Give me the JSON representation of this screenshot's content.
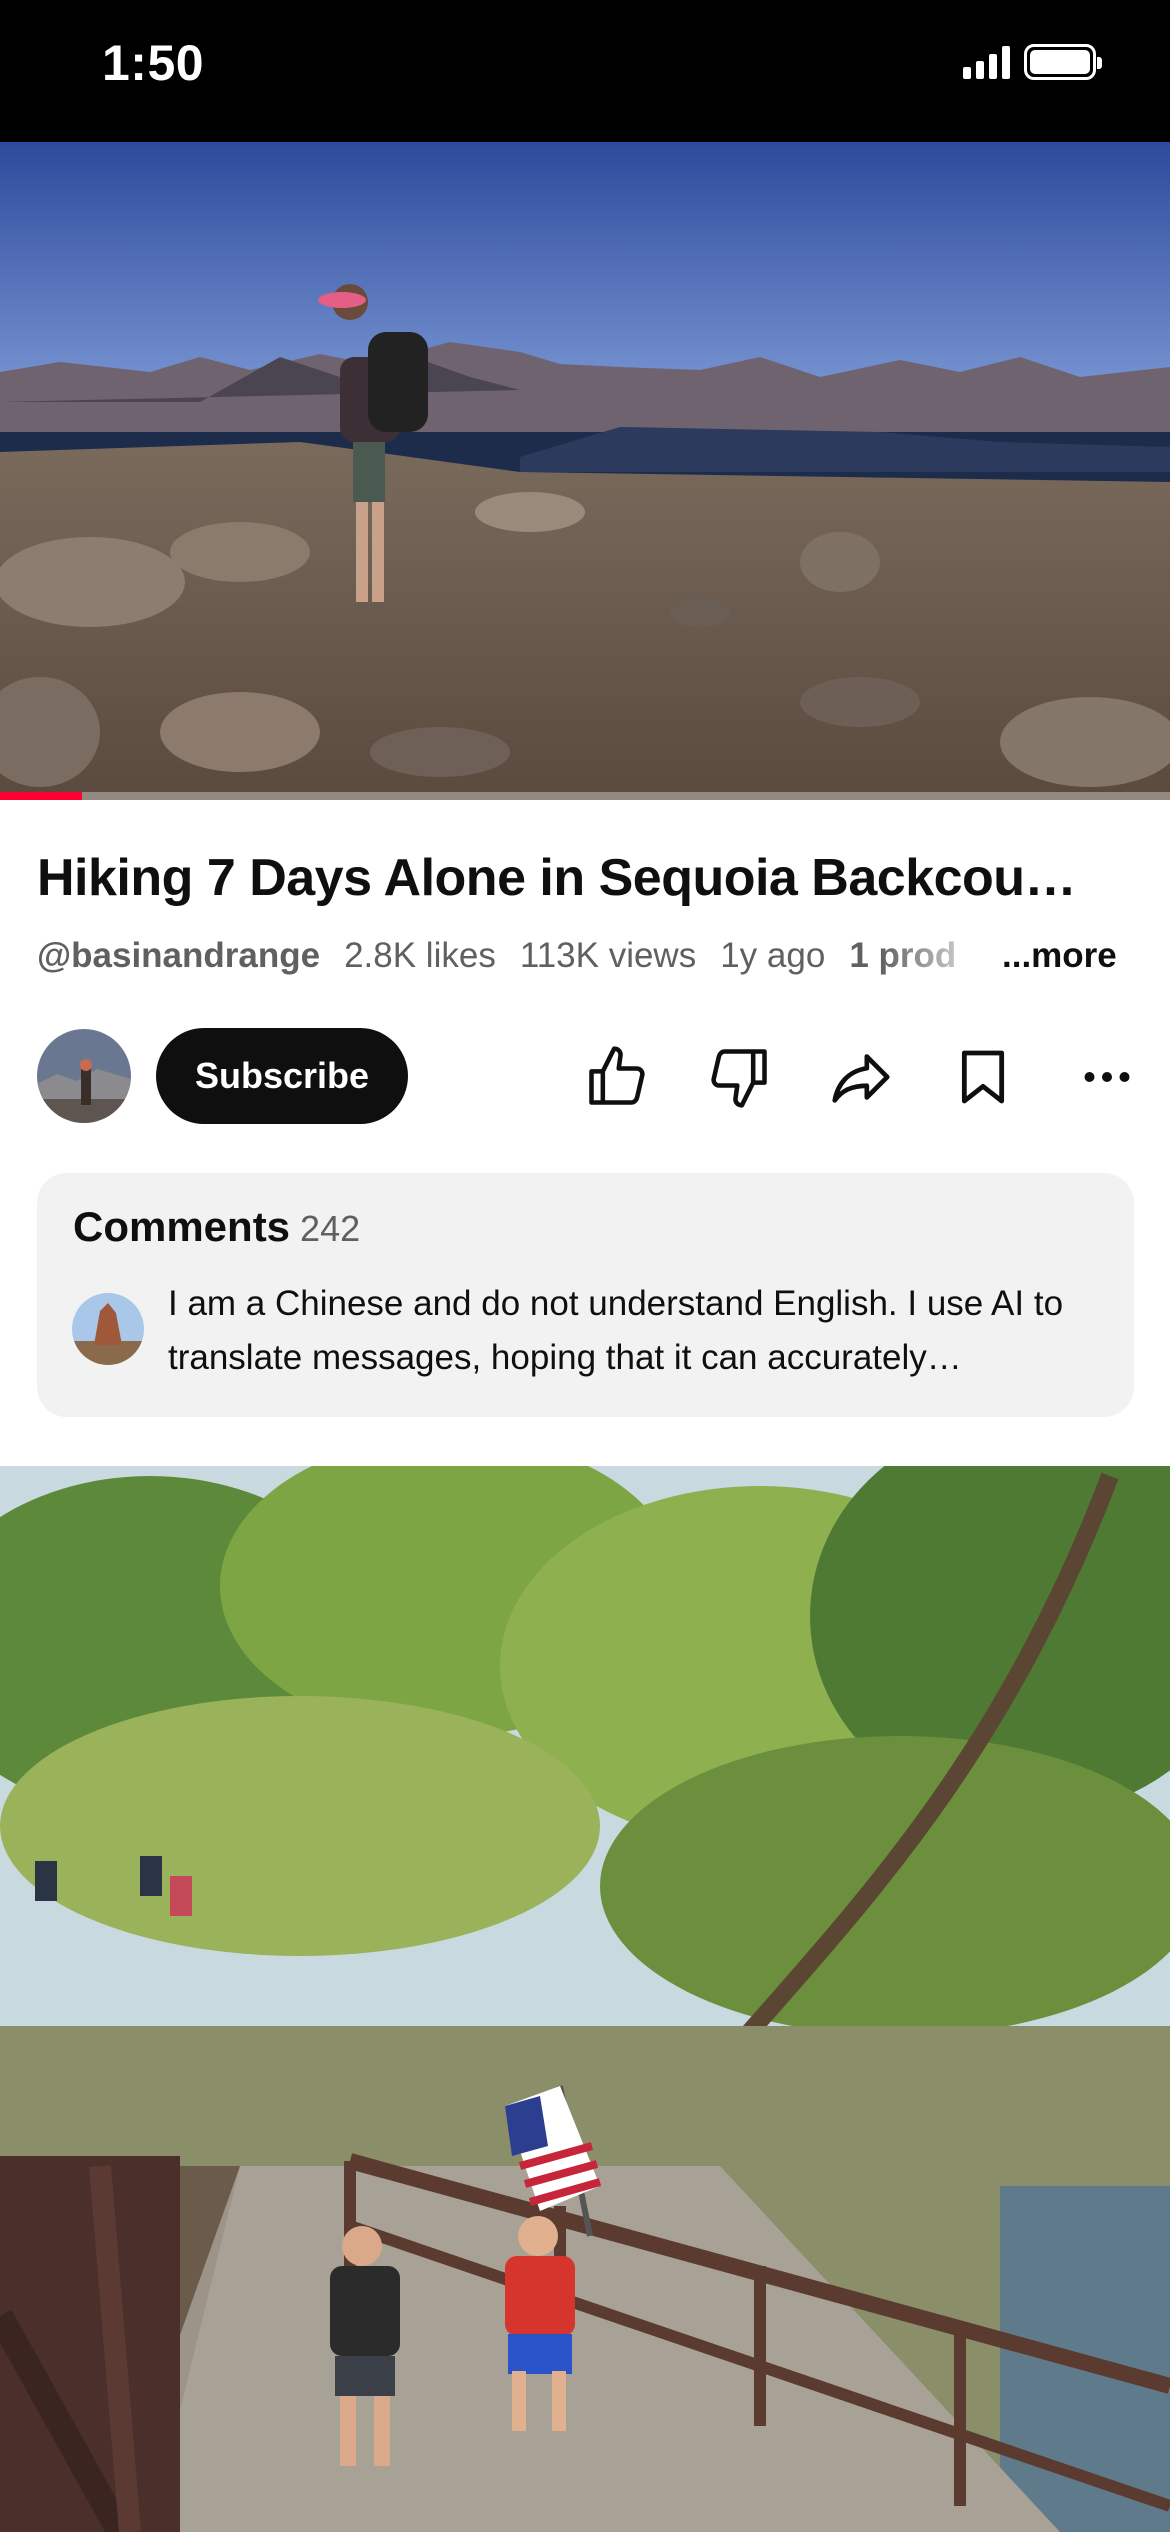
{
  "status": {
    "time": "1:50"
  },
  "video": {
    "title": "Hiking 7 Days Alone in Sequoia Backcou…",
    "channel_handle": "@basinandrange",
    "likes": "2.8K likes",
    "views": "113K views",
    "age": "1y ago",
    "products": "1 prod",
    "more_label": "...more",
    "progress": 0.07
  },
  "actions": {
    "subscribe_label": "Subscribe"
  },
  "comments": {
    "heading": "Comments",
    "count": "242",
    "top_comment": "I am a Chinese and do not understand English. I use AI to translate messages, hoping that it can accurately…"
  },
  "colors": {
    "accent": "#ff0033",
    "subscribe_bg": "#0f0f0f",
    "comments_bg": "#f2f2f2"
  }
}
